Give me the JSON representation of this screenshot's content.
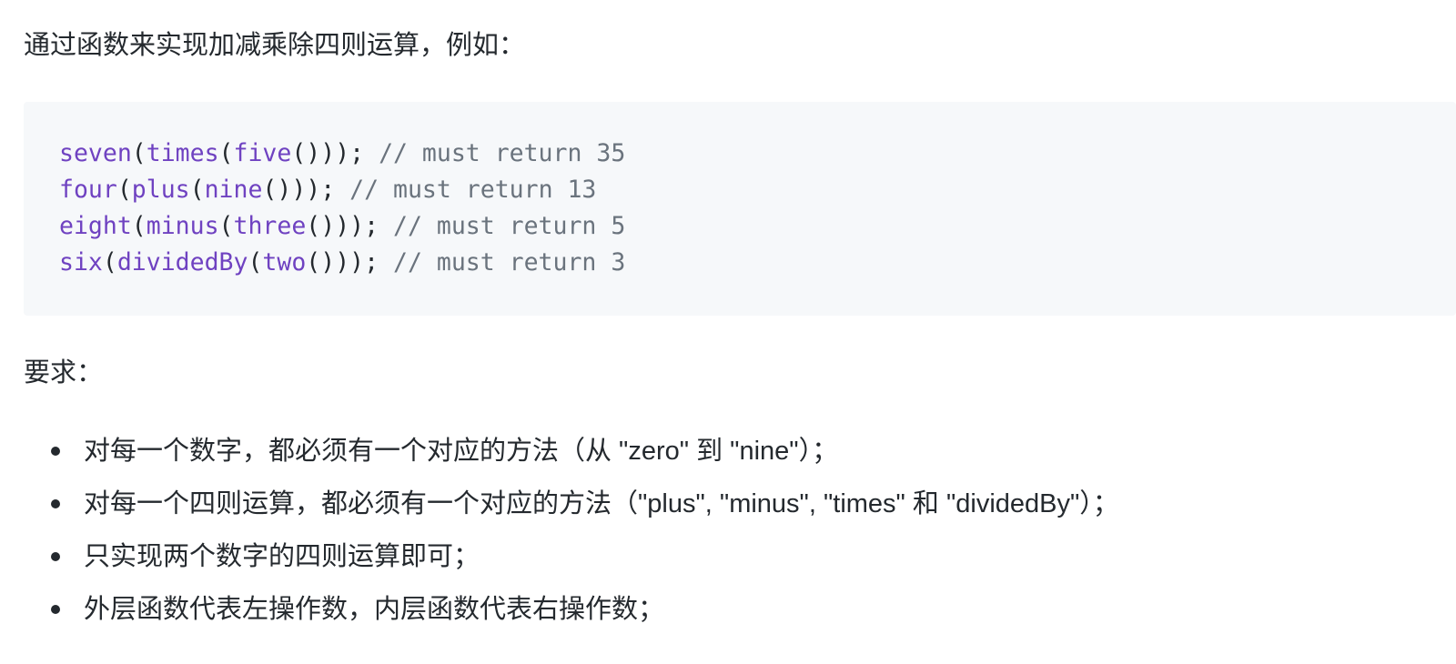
{
  "intro_text": "通过函数来实现加减乘除四则运算，例如：",
  "code_lines": [
    {
      "outer": "seven",
      "inner": "times",
      "arg": "five",
      "close": "()));",
      "comment": " // must return 35"
    },
    {
      "outer": "four",
      "inner": "plus",
      "arg": "nine",
      "close": "()));",
      "comment": " // must return 13"
    },
    {
      "outer": "eight",
      "inner": "minus",
      "arg": "three",
      "close": "()));",
      "comment": " // must return 5"
    },
    {
      "outer": "six",
      "inner": "dividedBy",
      "arg": "two",
      "close": "()));",
      "comment": " // must return 3"
    }
  ],
  "requirements_label": "要求：",
  "requirements": [
    "对每一个数字，都必须有一个对应的方法（从 \"zero\" 到 \"nine\"）；",
    "对每一个四则运算，都必须有一个对应的方法（\"plus\", \"minus\", \"times\" 和 \"dividedBy\"）；",
    "只实现两个数字的四则运算即可；",
    "外层函数代表左操作数，内层函数代表右操作数；"
  ]
}
